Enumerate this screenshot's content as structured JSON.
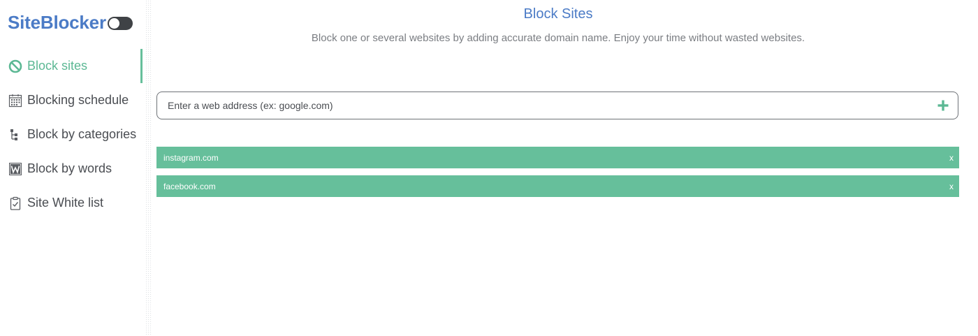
{
  "brand": {
    "title": "SiteBlocker",
    "toggle_state": "off"
  },
  "sidebar": {
    "items": [
      {
        "label": "Block sites",
        "icon": "block-icon",
        "active": true
      },
      {
        "label": "Blocking schedule",
        "icon": "calendar-icon",
        "active": false
      },
      {
        "label": "Block by categories",
        "icon": "tree-icon",
        "active": false
      },
      {
        "label": "Block by words",
        "icon": "word-w-icon",
        "active": false
      },
      {
        "label": "Site White list",
        "icon": "clipboard-check-icon",
        "active": false
      }
    ]
  },
  "main": {
    "title": "Block Sites",
    "subtitle": "Block one or several websites by adding accurate domain name. Enjoy your time without wasted websites.",
    "input": {
      "placeholder": "Enter a web address (ex: google.com)",
      "value": ""
    },
    "add_icon": "plus-icon",
    "blocked_sites": [
      {
        "domain": "instagram.com",
        "remove_label": "x"
      },
      {
        "domain": "facebook.com",
        "remove_label": "x"
      }
    ]
  },
  "colors": {
    "accent_green": "#66bf9b",
    "brand_blue": "#4b7bc6",
    "text_gray": "#4a4d52",
    "subtitle_gray": "#7a7d82"
  }
}
